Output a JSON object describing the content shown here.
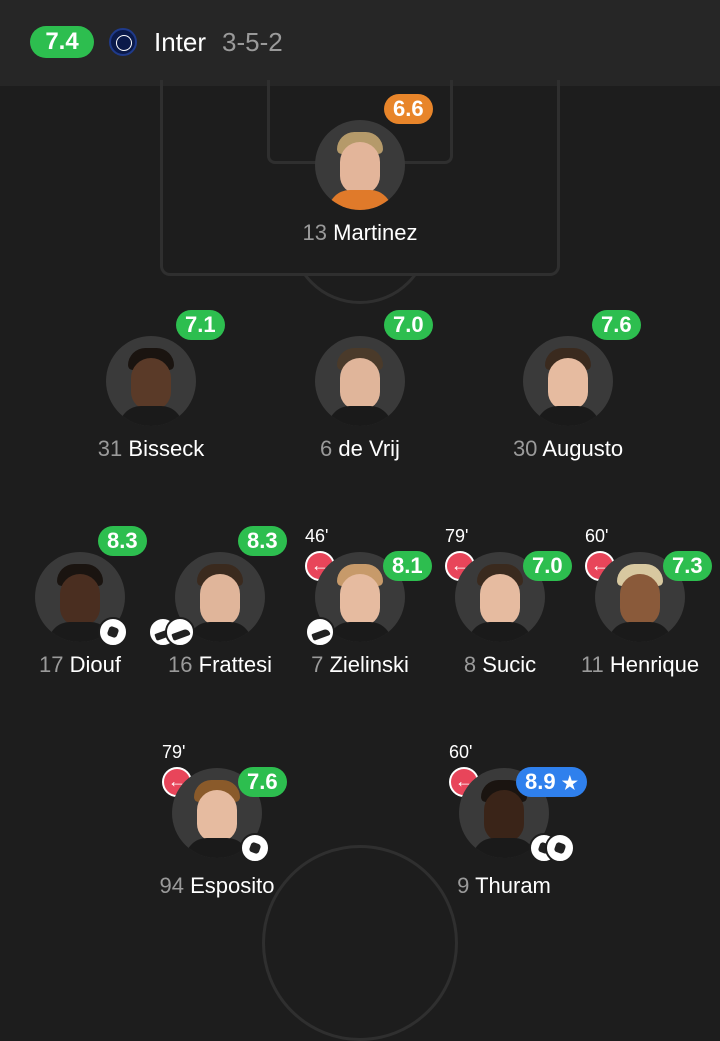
{
  "team": {
    "rating": "7.4",
    "name": "Inter",
    "formation": "3-5-2",
    "logo_icon": "inter-crest-icon"
  },
  "colors": {
    "green": "#2dbe4f",
    "orange": "#e8852a",
    "blue": "#2f80ed",
    "sub_red": "#e8455a"
  },
  "players": {
    "martinez": {
      "number": "13",
      "name": "Martinez",
      "rating": "6.6"
    },
    "bisseck": {
      "number": "31",
      "name": "Bisseck",
      "rating": "7.1"
    },
    "devrij": {
      "number": "6",
      "name": "de Vrij",
      "rating": "7.0"
    },
    "augusto": {
      "number": "30",
      "name": "Augusto",
      "rating": "7.6"
    },
    "diouf": {
      "number": "17",
      "name": "Diouf",
      "rating": "8.3",
      "events": [
        "goal-icon"
      ]
    },
    "frattesi": {
      "number": "16",
      "name": "Frattesi",
      "rating": "8.3",
      "events": [
        "assist-icon",
        "assist-icon"
      ]
    },
    "zielinski": {
      "number": "7",
      "name": "Zielinski",
      "rating": "8.1",
      "sub_minute": "46'",
      "events": [
        "assist-icon"
      ]
    },
    "sucic": {
      "number": "8",
      "name": "Sucic",
      "rating": "7.0",
      "sub_minute": "79'"
    },
    "henrique": {
      "number": "11",
      "name": "Henrique",
      "rating": "7.3",
      "sub_minute": "60'"
    },
    "esposito": {
      "number": "94",
      "name": "Esposito",
      "rating": "7.6",
      "sub_minute": "79'",
      "events": [
        "goal-icon"
      ]
    },
    "thuram": {
      "number": "9",
      "name": "Thuram",
      "rating": "8.9",
      "sub_minute": "60'",
      "man_of_match": "★",
      "events": [
        "goal-icon",
        "goal-icon"
      ]
    }
  }
}
